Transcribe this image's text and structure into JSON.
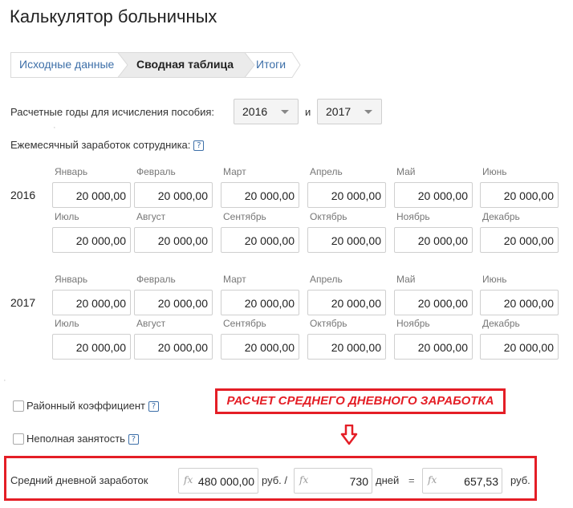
{
  "app": {
    "title": "Калькулятор больничных"
  },
  "steps": [
    {
      "label": "Исходные данные",
      "state": "done"
    },
    {
      "label": "Сводная таблица",
      "state": "active"
    },
    {
      "label": "Итоги",
      "state": "pending"
    }
  ],
  "years_selector": {
    "label": "Расчетные годы для исчисления пособия:",
    "year1": "2016",
    "and_label": "и",
    "year2": "2017"
  },
  "monthly_earnings": {
    "label": "Ежемесячный заработок сотрудника:",
    "help_icon": "?"
  },
  "earnings_2016": {
    "year": "2016",
    "months_row1": [
      "Январь",
      "Февраль",
      "Март",
      "Апрель",
      "Май",
      "Июнь"
    ],
    "values_row1": [
      "20 000,00",
      "20 000,00",
      "20 000,00",
      "20 000,00",
      "20 000,00",
      "20 000,00"
    ],
    "months_row2": [
      "Июль",
      "Август",
      "Сентябрь",
      "Октябрь",
      "Ноябрь",
      "Декабрь"
    ],
    "values_row2": [
      "20 000,00",
      "20 000,00",
      "20 000,00",
      "20 000,00",
      "20 000,00",
      "20 000,00"
    ]
  },
  "earnings_2017": {
    "year": "2017",
    "months_row1": [
      "Январь",
      "Февраль",
      "Март",
      "Апрель",
      "Май",
      "Июнь"
    ],
    "values_row1": [
      "20 000,00",
      "20 000,00",
      "20 000,00",
      "20 000,00",
      "20 000,00",
      "20 000,00"
    ],
    "months_row2": [
      "Июль",
      "Август",
      "Сентябрь",
      "Октябрь",
      "Ноябрь",
      "Декабрь"
    ],
    "values_row2": [
      "20 000,00",
      "20 000,00",
      "20 000,00",
      "20 000,00",
      "20 000,00",
      "20 000,00"
    ]
  },
  "options": {
    "regional": {
      "label": "Районный коэффициент",
      "help_icon": "?",
      "checked": false
    },
    "part_time": {
      "label": "Неполная занятость",
      "help_icon": "?",
      "checked": false
    }
  },
  "annotation": {
    "banner": "РАСЧЕТ СРЕДНЕГО ДНЕВНОГО ЗАРАБОТКА",
    "arrow_icon": "down-arrow-icon",
    "color": "#e41e26"
  },
  "average": {
    "label": "Средний дневной заработок",
    "fx": "fx",
    "total": "480 000,00",
    "rub_slash": "руб. /",
    "days": "730",
    "days_label": "дней",
    "equals": "=",
    "result": "657,53",
    "rub": "руб."
  },
  "colors": {
    "link": "#3d6fa8",
    "highlight": "#e41e26",
    "border": "#cfcfcf"
  }
}
